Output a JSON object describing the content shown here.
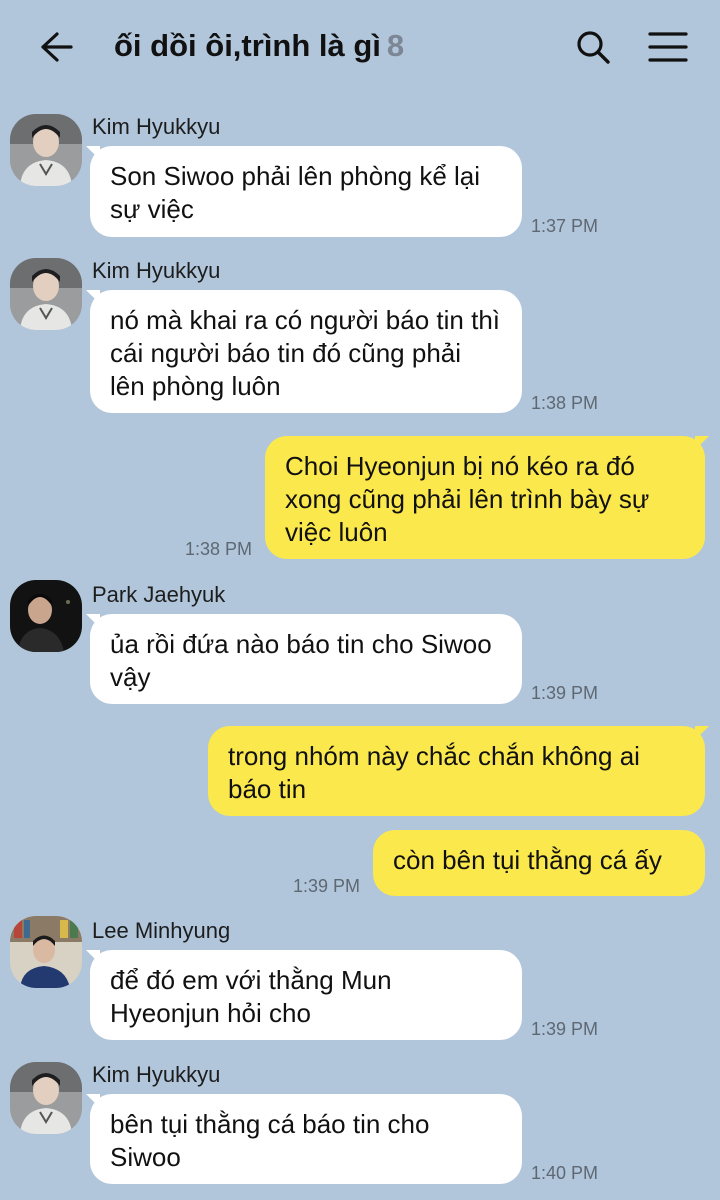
{
  "header": {
    "title": "ối dồi ôi,trình là gì",
    "member_count": "8",
    "back_icon": "arrow-left-icon",
    "search_icon": "search-icon",
    "menu_icon": "hamburger-menu-icon"
  },
  "colors": {
    "background": "#b1c6db",
    "incoming_bubble": "#ffffff",
    "outgoing_bubble": "#fbe84d"
  },
  "messages": [
    {
      "sender": "Kim Hyukkyu",
      "text": "Son Siwoo phải lên phòng kể lại sự việc",
      "time": "1:37 PM"
    },
    {
      "sender": "Kim Hyukkyu",
      "text": "nó mà khai ra có người báo tin thì cái người báo tin đó cũng phải lên phòng luôn",
      "time": "1:38 PM"
    },
    {
      "text": "Choi Hyeonjun bị nó kéo ra đó xong cũng phải lên trình bày sự việc luôn",
      "time": "1:38 PM"
    },
    {
      "sender": "Park Jaehyuk",
      "text": "ủa rồi đứa nào báo tin cho Siwoo vậy",
      "time": "1:39 PM"
    },
    {
      "text": "trong nhóm này chắc chắn không ai báo tin"
    },
    {
      "text": "còn bên tụi thằng cá ấy",
      "time": "1:39 PM"
    },
    {
      "sender": "Lee Minhyung",
      "text": "để đó em với thằng Mun Hyeonjun hỏi cho",
      "time": "1:39 PM"
    },
    {
      "sender": "Kim Hyukkyu",
      "text": "bên tụi thằng cá báo tin cho Siwoo",
      "time": "1:40 PM"
    }
  ]
}
